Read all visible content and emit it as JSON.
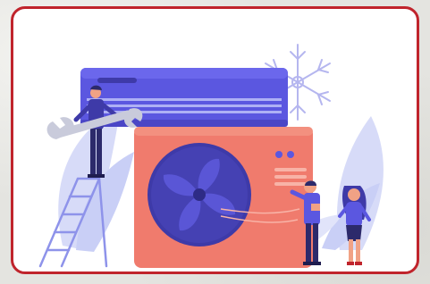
{
  "image": {
    "subject": "ac-installation-illustration"
  },
  "colors": {
    "frame_border": "#c0242c",
    "card_background": "#ffffff",
    "indoor_unit": "#5b57e0",
    "outdoor_unit": "#f07b6d",
    "fan": "#3e3aa8",
    "foliage": "#c9cff6",
    "snowflake": "#b5b6ef"
  }
}
